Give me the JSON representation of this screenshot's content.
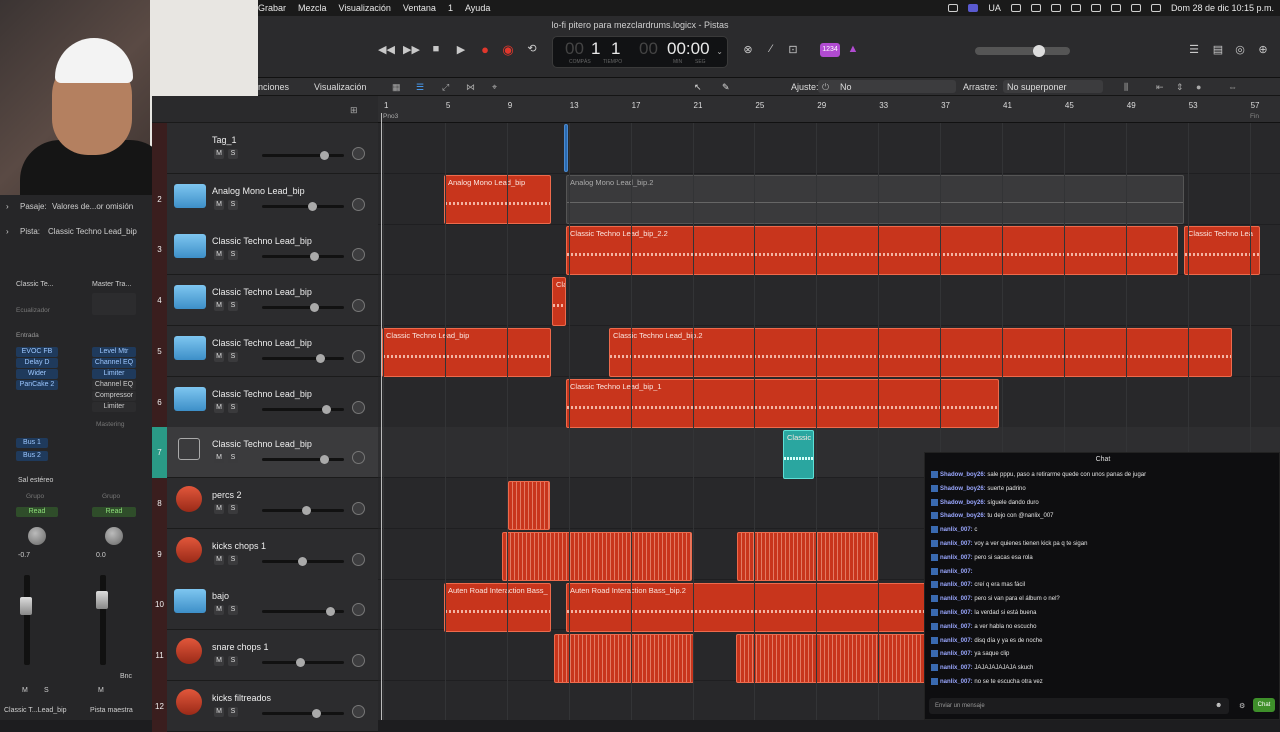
{
  "menubar": {
    "items": [
      "Grabar",
      "Mezcla",
      "Visualización",
      "Ventana",
      "1",
      "Ayuda"
    ],
    "badge": "UA",
    "datetime": "Dom 28 de dic  10:15 p.m."
  },
  "window": {
    "title": "lo-fi pitero para mezclardrums.logicx - Pistas"
  },
  "lcd": {
    "bar": "1",
    "beat": "1",
    "time": "00:00",
    "label_compas": "COMPÁS",
    "label_tiempo": "TIEMPO",
    "label_min": "MIN",
    "label_seg": "SEG",
    "count_badge": "1234"
  },
  "editbar": {
    "menu1": "nciones",
    "menu2": "Visualización",
    "ajuste_label": "Ajuste:",
    "ajuste_value": "No",
    "arrastre_label": "Arrastre:",
    "arrastre_value": "No superponer"
  },
  "inspector": {
    "pasaje_label": "Pasaje:",
    "pasaje_value": "Valores de...or omisión",
    "pista_label": "Pista:",
    "pista_value": "Classic Techno Lead_bip",
    "strip1_name": "Classic Te...",
    "strip2_name": "Master Tra...",
    "ecualizador": "Ecualizador",
    "entrada": "Entrada",
    "plugins_left": [
      "EVOC FB",
      "Delay D",
      "Wider",
      "PanCake 2"
    ],
    "plugins_right": [
      "Level Mtr",
      "Channel EQ",
      "Limiter",
      "Channel EQ",
      "Compressor",
      "Limiter"
    ],
    "mastering": "Mastering",
    "bus1": "Bus 1",
    "bus2": "Bus 2",
    "sal_estereo": "Sal estéreo",
    "grupo": "Grupo",
    "read": "Read",
    "value_left": "-0.7",
    "value_right": "0.0",
    "bnc": "Bnc",
    "m": "M",
    "s": "S",
    "footer_left": "Classic T...Lead_bip",
    "footer_right": "Pista maestra"
  },
  "tracks": [
    {
      "num": "",
      "name": "Tag_1",
      "icon": "none"
    },
    {
      "num": "2",
      "name": "Analog Mono Lead_bip",
      "icon": "folder-icon"
    },
    {
      "num": "3",
      "name": "Classic Techno Lead_bip",
      "icon": "folder-icon"
    },
    {
      "num": "4",
      "name": "Classic Techno Lead_bip",
      "icon": "folder-icon"
    },
    {
      "num": "5",
      "name": "Classic Techno Lead_bip",
      "icon": "folder-icon"
    },
    {
      "num": "6",
      "name": "Classic Techno Lead_bip",
      "icon": "folder-icon"
    },
    {
      "num": "7",
      "name": "Classic Techno Lead_bip",
      "icon": "synth-icon"
    },
    {
      "num": "8",
      "name": "percs 2",
      "icon": "drum-icon"
    },
    {
      "num": "9",
      "name": "kicks chops 1",
      "icon": "drum-icon"
    },
    {
      "num": "10",
      "name": "bajo",
      "icon": "folder-icon"
    },
    {
      "num": "11",
      "name": "snare chops 1",
      "icon": "drum-icon"
    },
    {
      "num": "12",
      "name": "kicks filtreados",
      "icon": "drum-icon"
    }
  ],
  "ruler": {
    "bars": [
      "1",
      "5",
      "9",
      "13",
      "17",
      "21",
      "25",
      "29",
      "33",
      "37",
      "41",
      "45",
      "49",
      "53",
      "57"
    ],
    "marker_left": "Pno3",
    "marker_right": "Fin"
  },
  "regions": {
    "r2a": "Analog Mono Lead_bip",
    "r2b": "Analog Mono Lead_bip.2",
    "r3a": "Classic Techno Lead_bip_2.2",
    "r3b": "Classic Techno Lea",
    "r4a": "Cla",
    "r5a": "Classic Techno Lead_bip",
    "r5b": "Classic Techno Lead_bip.2",
    "r6a": "Classic Techno Lead_bip_1",
    "r7a": "Classic",
    "r10a": "Auten Road Interaction Bass_",
    "r10b": "Auten Road Interaction Bass_bip.2"
  },
  "chat": {
    "title": "Chat",
    "messages": [
      {
        "user": "Shadow_boy26:",
        "text": "sale pppu, paso a retirarme quede con unos panas de jugar"
      },
      {
        "user": "Shadow_boy26:",
        "text": "suerte padrino"
      },
      {
        "user": "Shadow_boy26:",
        "text": "síguele dando duro"
      },
      {
        "user": "Shadow_boy26:",
        "text": "tu dejo con @nanlix_007"
      },
      {
        "user": "nanlix_007:",
        "text": "c"
      },
      {
        "user": "nanlix_007:",
        "text": "voy a ver quienes tienen kick pa q te sigan"
      },
      {
        "user": "nanlix_007:",
        "text": "pero si sacas esa rola"
      },
      {
        "user": "nanlix_007:",
        "text": ""
      },
      {
        "user": "nanlix_007:",
        "text": "creí q era mas fácil"
      },
      {
        "user": "nanlix_007:",
        "text": "pero si van para el álbum o nel?"
      },
      {
        "user": "nanlix_007:",
        "text": "la verdad si está buena"
      },
      {
        "user": "nanlix_007:",
        "text": "a ver habla no escucho"
      },
      {
        "user": "nanlix_007:",
        "text": "disq día y ya es de noche"
      },
      {
        "user": "nanlix_007:",
        "text": "ya saque clip"
      },
      {
        "user": "nanlix_007:",
        "text": "JAJAJAJAJAJA skuch"
      },
      {
        "user": "nanlix_007:",
        "text": "no se te escucha otra vez"
      }
    ],
    "input_placeholder": "Enviar un mensaje",
    "send_label": "Chat"
  }
}
